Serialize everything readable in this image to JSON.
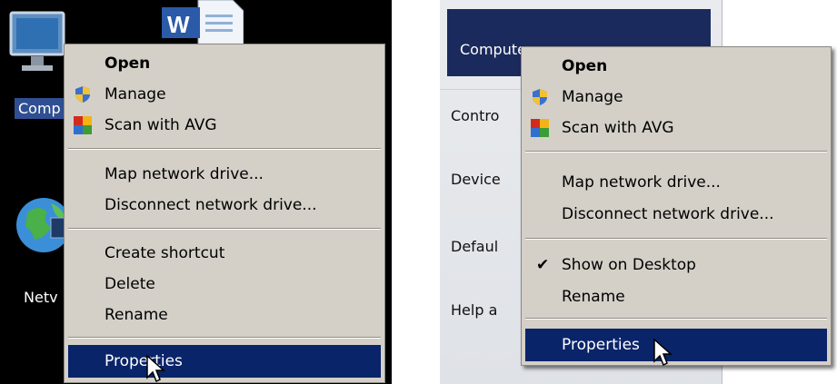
{
  "left": {
    "desktop": {
      "computer_label": "Comp",
      "network_label": "Netv"
    },
    "menu": {
      "items": [
        {
          "label": "Open",
          "bold": true
        },
        {
          "label": "Manage",
          "icon": "uac-shield-icon"
        },
        {
          "label": "Scan with AVG",
          "icon": "avg-icon"
        },
        {
          "label": "Map network drive..."
        },
        {
          "label": "Disconnect network drive..."
        },
        {
          "label": "Create shortcut"
        },
        {
          "label": "Delete"
        },
        {
          "label": "Rename"
        },
        {
          "label": "Properties",
          "highlighted": true
        }
      ]
    }
  },
  "right": {
    "start_menu": {
      "computer": "Computer",
      "items": [
        "Contro",
        "Device",
        "Defaul",
        "Help a"
      ]
    },
    "menu": {
      "items": [
        {
          "label": "Open",
          "bold": true
        },
        {
          "label": "Manage",
          "icon": "uac-shield-icon"
        },
        {
          "label": "Scan with AVG",
          "icon": "avg-icon"
        },
        {
          "label": "Map network drive..."
        },
        {
          "label": "Disconnect network drive..."
        },
        {
          "label": "Show on Desktop",
          "checked": true
        },
        {
          "label": "Rename"
        },
        {
          "label": "Properties",
          "highlighted": true
        }
      ]
    }
  },
  "colors": {
    "menu_bg": "#d4d0c8",
    "highlight": "#0a246a",
    "start_selected": "#1b2a5c"
  }
}
